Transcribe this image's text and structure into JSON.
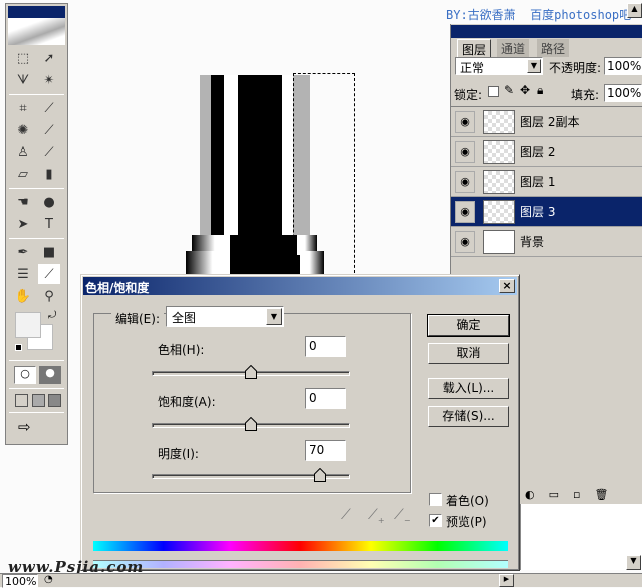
{
  "credit": "BY:古欲香萧  百度photoshop吧",
  "watermark": "www.Psjia.com",
  "toolbox": {
    "tools": [
      "marquee-icon",
      "move-icon",
      "lasso-icon",
      "magic-wand-icon",
      "crop-icon",
      "slice-icon",
      "healing-brush-icon",
      "brush-icon",
      "clone-stamp-icon",
      "history-brush-icon",
      "eraser-icon",
      "gradient-icon",
      "smudge-icon",
      "dodge-icon",
      "path-select-icon",
      "type-icon",
      "pen-icon",
      "shape-icon",
      "notes-icon",
      "eyedropper-icon",
      "hand-icon",
      "zoom-icon"
    ],
    "glyphs": [
      "⬚",
      "➚",
      "ᗐ",
      "✴",
      "⌗",
      "⟋",
      "✺",
      "⟋",
      "♙",
      "⟋",
      "▱",
      "▮",
      "☚",
      "●",
      "➤",
      "T",
      "✒",
      "■",
      "☰",
      "⟋",
      "✋",
      "⚲"
    ],
    "foreground_color": "#f2f2f2",
    "background_color": "#ffffff"
  },
  "layers_panel": {
    "tabs": [
      "图层",
      "通道",
      "路径"
    ],
    "blend_mode": "正常",
    "opacity_label": "不透明度:",
    "opacity": "100%",
    "lock_label": "锁定:",
    "fill_label": "填充:",
    "fill": "100%",
    "layers": [
      {
        "name": "图层 2副本",
        "selected": false
      },
      {
        "name": "图层 2",
        "selected": false
      },
      {
        "name": "图层 1",
        "selected": false
      },
      {
        "name": "图层 3",
        "selected": true
      },
      {
        "name": "背景",
        "selected": false
      }
    ]
  },
  "dialog": {
    "title": "色相/饱和度",
    "edit_label": "编辑(E):",
    "edit_value": "全图",
    "hue_label": "色相(H):",
    "hue_value": "0",
    "hue_range": [
      -180,
      180
    ],
    "saturation_label": "饱和度(A):",
    "saturation_value": "0",
    "saturation_range": [
      -100,
      100
    ],
    "lightness_label": "明度(I):",
    "lightness_value": "70",
    "lightness_range": [
      -100,
      100
    ],
    "ok_label": "确定",
    "cancel_label": "取消",
    "load_label": "载入(L)...",
    "save_label": "存储(S)...",
    "colorize_label": "着色(O)",
    "colorize_checked": false,
    "preview_label": "预览(P)",
    "preview_checked": true
  },
  "status_bar": {
    "zoom": "100%"
  },
  "colors": {
    "titlebar": "#0a246a",
    "chrome": "#d4d0c8",
    "credit_text": "#3a6fc4"
  }
}
